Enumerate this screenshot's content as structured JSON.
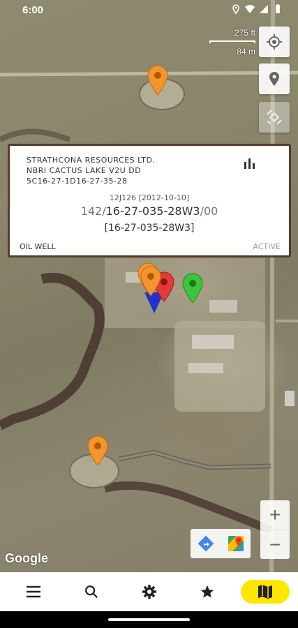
{
  "status_bar": {
    "time": "6:00",
    "icons": [
      "location-icon",
      "wifi-icon",
      "signal-icon",
      "battery-icon"
    ]
  },
  "scale": {
    "feet": "275 ft",
    "meters": "84 m"
  },
  "info_card": {
    "company": "STRATHCONA RESOURCES LTD.",
    "well_name": "NBRI CACTUS LAKE V2U DD",
    "uwi": "5C16-27-1D16-27-35-28",
    "license": "12J126 [2012-10-10]",
    "location_prefix": "142/",
    "location_main": "16-27-035-28W3",
    "location_suffix": "/00",
    "location_bracket": "[16-27-035-28W3]",
    "well_type": "OIL WELL",
    "status": "ACTIVE",
    "chart_icon": "bar-chart-icon"
  },
  "right_controls": [
    {
      "name": "my-location-icon"
    },
    {
      "name": "place-marker-icon"
    },
    {
      "name": "satellite-layer-icon"
    },
    {
      "name": "add-location-icon"
    },
    {
      "name": "favorite-star-icon"
    },
    {
      "name": "search-icon"
    }
  ],
  "markers": [
    {
      "color": "#f2952c"
    },
    {
      "color": "#f2952c"
    },
    {
      "color": "#e53935"
    },
    {
      "color": "#2962ff"
    },
    {
      "color": "#3cc43c"
    },
    {
      "color": "#f2952c"
    }
  ],
  "zoom": {
    "in_label": "+",
    "out_label": "−"
  },
  "map_attribution": "Google",
  "bottom_nav": [
    {
      "name": "menu-icon",
      "active": false
    },
    {
      "name": "search-icon",
      "active": false
    },
    {
      "name": "settings-icon",
      "active": false
    },
    {
      "name": "star-icon",
      "active": false
    },
    {
      "name": "map-icon",
      "active": true
    }
  ],
  "colors": {
    "card_border": "#5a3a2e",
    "active_nav": "#ffe600",
    "marker_orange": "#f2952c",
    "marker_red": "#e53935",
    "marker_blue": "#2962ff",
    "marker_green": "#3cc43c"
  }
}
